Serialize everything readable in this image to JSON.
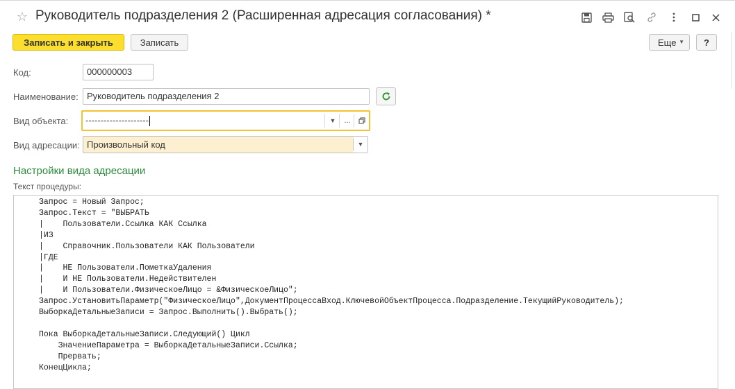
{
  "window": {
    "title": "Руководитель подразделения 2 (Расширенная адресация согласования) *"
  },
  "icons": {
    "favorite": "star-icon",
    "save": "floppy-disk-icon",
    "print": "printer-icon",
    "preview": "search-document-icon",
    "link": "link-icon",
    "more": "vertical-dots-icon",
    "maximize": "square-icon",
    "close": "close-icon",
    "refresh": "refresh-icon",
    "open": "open-window-icon"
  },
  "toolbar": {
    "save_close_label": "Записать и закрыть",
    "save_label": "Записать",
    "more_label": "Еще",
    "help_label": "?"
  },
  "form": {
    "code": {
      "label": "Код:",
      "value": "000000003"
    },
    "name": {
      "label": "Наименование:",
      "value": "Руководитель подразделения 2"
    },
    "object_type": {
      "label": "Вид объекта:",
      "value": "---------------------",
      "more_label": "..."
    },
    "addressing_type": {
      "label": "Вид адресации:",
      "value": "Произвольный код"
    }
  },
  "settings": {
    "section_title": "Настройки вида адресации",
    "procedure_label": "Текст процедуры:",
    "code_lines": [
      "Запрос = Новый Запрос;",
      "Запрос.Текст = \"ВЫБРАТЬ",
      "|    Пользователи.Ссылка КАК Ссылка",
      "|ИЗ",
      "|    Справочник.Пользователи КАК Пользователи",
      "|ГДЕ",
      "|    НЕ Пользователи.ПометкаУдаления",
      "|    И НЕ Пользователи.Недействителен",
      "|    И Пользователи.ФизическоеЛицо = &ФизическоеЛицо\";",
      "Запрос.УстановитьПараметр(\"ФизическоеЛицо\",ДокументПроцессаВход.КлючевойОбъектПроцесса.Подразделение.ТекущийРуководитель);",
      "ВыборкаДетальныеЗаписи = Запрос.Выполнить().Выбрать();",
      "",
      "Пока ВыборкаДетальныеЗаписи.Следующий() Цикл",
      "    ЗначениеПараметра = ВыборкаДетальныеЗаписи.Ссылка;",
      "    Прервать;",
      "КонецЦикла;"
    ]
  },
  "colors": {
    "primary_button": "#fcdf2e",
    "section_title": "#2e8b3d",
    "focus_border": "#f1c232",
    "dropdown_fill": "#fdf0d0"
  }
}
